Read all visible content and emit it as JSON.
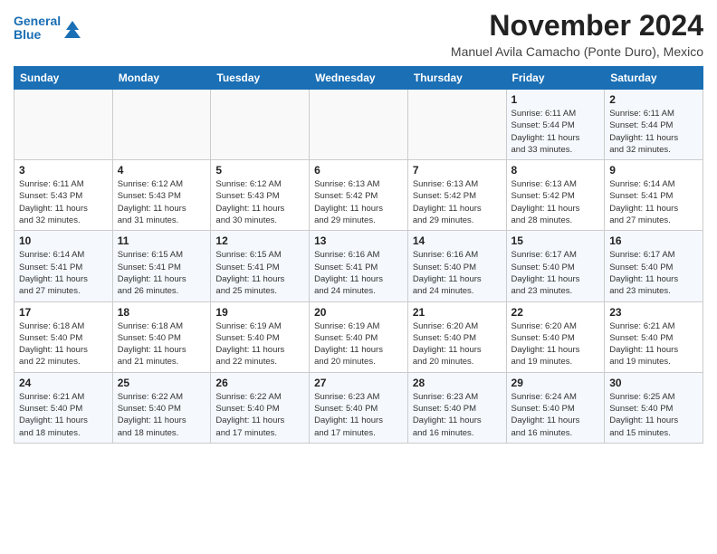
{
  "logo": {
    "line1": "General",
    "line2": "Blue"
  },
  "title": "November 2024",
  "subtitle": "Manuel Avila Camacho (Ponte Duro), Mexico",
  "days_of_week": [
    "Sunday",
    "Monday",
    "Tuesday",
    "Wednesday",
    "Thursday",
    "Friday",
    "Saturday"
  ],
  "weeks": [
    [
      {
        "date": "",
        "info": ""
      },
      {
        "date": "",
        "info": ""
      },
      {
        "date": "",
        "info": ""
      },
      {
        "date": "",
        "info": ""
      },
      {
        "date": "",
        "info": ""
      },
      {
        "date": "1",
        "info": "Sunrise: 6:11 AM\nSunset: 5:44 PM\nDaylight: 11 hours\nand 33 minutes."
      },
      {
        "date": "2",
        "info": "Sunrise: 6:11 AM\nSunset: 5:44 PM\nDaylight: 11 hours\nand 32 minutes."
      }
    ],
    [
      {
        "date": "3",
        "info": "Sunrise: 6:11 AM\nSunset: 5:43 PM\nDaylight: 11 hours\nand 32 minutes."
      },
      {
        "date": "4",
        "info": "Sunrise: 6:12 AM\nSunset: 5:43 PM\nDaylight: 11 hours\nand 31 minutes."
      },
      {
        "date": "5",
        "info": "Sunrise: 6:12 AM\nSunset: 5:43 PM\nDaylight: 11 hours\nand 30 minutes."
      },
      {
        "date": "6",
        "info": "Sunrise: 6:13 AM\nSunset: 5:42 PM\nDaylight: 11 hours\nand 29 minutes."
      },
      {
        "date": "7",
        "info": "Sunrise: 6:13 AM\nSunset: 5:42 PM\nDaylight: 11 hours\nand 29 minutes."
      },
      {
        "date": "8",
        "info": "Sunrise: 6:13 AM\nSunset: 5:42 PM\nDaylight: 11 hours\nand 28 minutes."
      },
      {
        "date": "9",
        "info": "Sunrise: 6:14 AM\nSunset: 5:41 PM\nDaylight: 11 hours\nand 27 minutes."
      }
    ],
    [
      {
        "date": "10",
        "info": "Sunrise: 6:14 AM\nSunset: 5:41 PM\nDaylight: 11 hours\nand 27 minutes."
      },
      {
        "date": "11",
        "info": "Sunrise: 6:15 AM\nSunset: 5:41 PM\nDaylight: 11 hours\nand 26 minutes."
      },
      {
        "date": "12",
        "info": "Sunrise: 6:15 AM\nSunset: 5:41 PM\nDaylight: 11 hours\nand 25 minutes."
      },
      {
        "date": "13",
        "info": "Sunrise: 6:16 AM\nSunset: 5:41 PM\nDaylight: 11 hours\nand 24 minutes."
      },
      {
        "date": "14",
        "info": "Sunrise: 6:16 AM\nSunset: 5:40 PM\nDaylight: 11 hours\nand 24 minutes."
      },
      {
        "date": "15",
        "info": "Sunrise: 6:17 AM\nSunset: 5:40 PM\nDaylight: 11 hours\nand 23 minutes."
      },
      {
        "date": "16",
        "info": "Sunrise: 6:17 AM\nSunset: 5:40 PM\nDaylight: 11 hours\nand 23 minutes."
      }
    ],
    [
      {
        "date": "17",
        "info": "Sunrise: 6:18 AM\nSunset: 5:40 PM\nDaylight: 11 hours\nand 22 minutes."
      },
      {
        "date": "18",
        "info": "Sunrise: 6:18 AM\nSunset: 5:40 PM\nDaylight: 11 hours\nand 21 minutes."
      },
      {
        "date": "19",
        "info": "Sunrise: 6:19 AM\nSunset: 5:40 PM\nDaylight: 11 hours\nand 22 minutes."
      },
      {
        "date": "20",
        "info": "Sunrise: 6:19 AM\nSunset: 5:40 PM\nDaylight: 11 hours\nand 20 minutes."
      },
      {
        "date": "21",
        "info": "Sunrise: 6:20 AM\nSunset: 5:40 PM\nDaylight: 11 hours\nand 20 minutes."
      },
      {
        "date": "22",
        "info": "Sunrise: 6:20 AM\nSunset: 5:40 PM\nDaylight: 11 hours\nand 19 minutes."
      },
      {
        "date": "23",
        "info": "Sunrise: 6:21 AM\nSunset: 5:40 PM\nDaylight: 11 hours\nand 19 minutes."
      }
    ],
    [
      {
        "date": "24",
        "info": "Sunrise: 6:21 AM\nSunset: 5:40 PM\nDaylight: 11 hours\nand 18 minutes."
      },
      {
        "date": "25",
        "info": "Sunrise: 6:22 AM\nSunset: 5:40 PM\nDaylight: 11 hours\nand 18 minutes."
      },
      {
        "date": "26",
        "info": "Sunrise: 6:22 AM\nSunset: 5:40 PM\nDaylight: 11 hours\nand 17 minutes."
      },
      {
        "date": "27",
        "info": "Sunrise: 6:23 AM\nSunset: 5:40 PM\nDaylight: 11 hours\nand 17 minutes."
      },
      {
        "date": "28",
        "info": "Sunrise: 6:23 AM\nSunset: 5:40 PM\nDaylight: 11 hours\nand 16 minutes."
      },
      {
        "date": "29",
        "info": "Sunrise: 6:24 AM\nSunset: 5:40 PM\nDaylight: 11 hours\nand 16 minutes."
      },
      {
        "date": "30",
        "info": "Sunrise: 6:25 AM\nSunset: 5:40 PM\nDaylight: 11 hours\nand 15 minutes."
      }
    ]
  ]
}
